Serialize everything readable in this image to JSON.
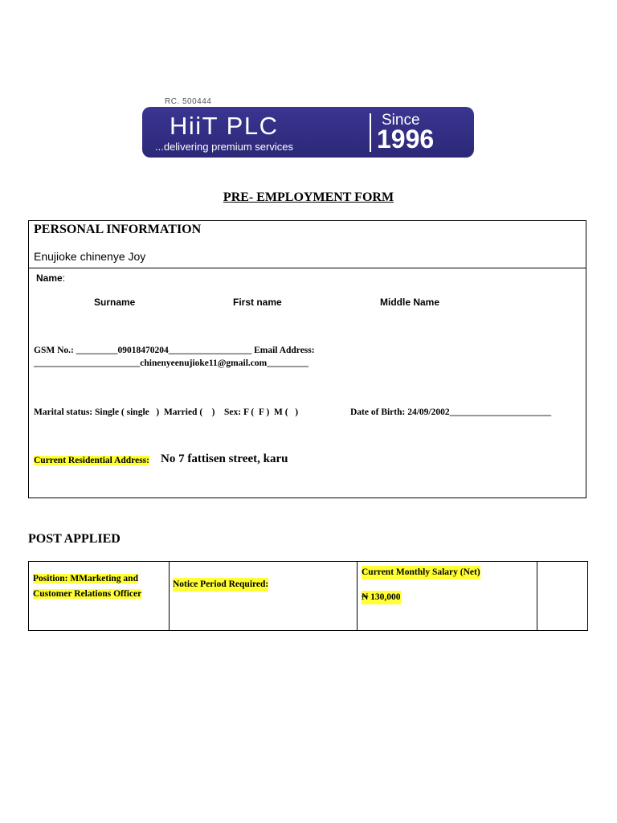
{
  "logo": {
    "rc_number": "RC. 500444",
    "company_name": "HiiT PLC",
    "tagline": "...delivering premium services",
    "since_label": "Since",
    "since_year": "1996",
    "background_color": "#2c2878"
  },
  "form": {
    "title": "PRE- EMPLOYMENT FORM"
  },
  "personal_information": {
    "heading": "PERSONAL INFORMATION",
    "applicant_name": "Enujioke chinenye Joy",
    "name_label": "Name",
    "name_suffix": ":",
    "columns": {
      "surname": "Surname",
      "first_name": "First name",
      "middle_name": "Middle Name"
    },
    "gsm_line": "GSM No.: _________09018470204__________________ Email Address:",
    "email_line": "_______________________chinenyeenujioke11@gmail.com_________",
    "marital_line": "Marital status: Single ( single   )  Married (    )    Sex: F (  F )  M (   )",
    "dob_line": "Date of Birth: 24/09/2002______________________",
    "address_label": "Current Residential Address:",
    "address_value": "No 7 fattisen street, karu"
  },
  "post_applied": {
    "heading": "POST APPLIED",
    "position": "Position: MMarketing and Customer Relations Officer",
    "notice_period": "Notice Period Required:",
    "salary_label": "Current Monthly Salary (Net)",
    "salary_value": "₦ 130,000",
    "highlight_color": "#ffff33"
  }
}
